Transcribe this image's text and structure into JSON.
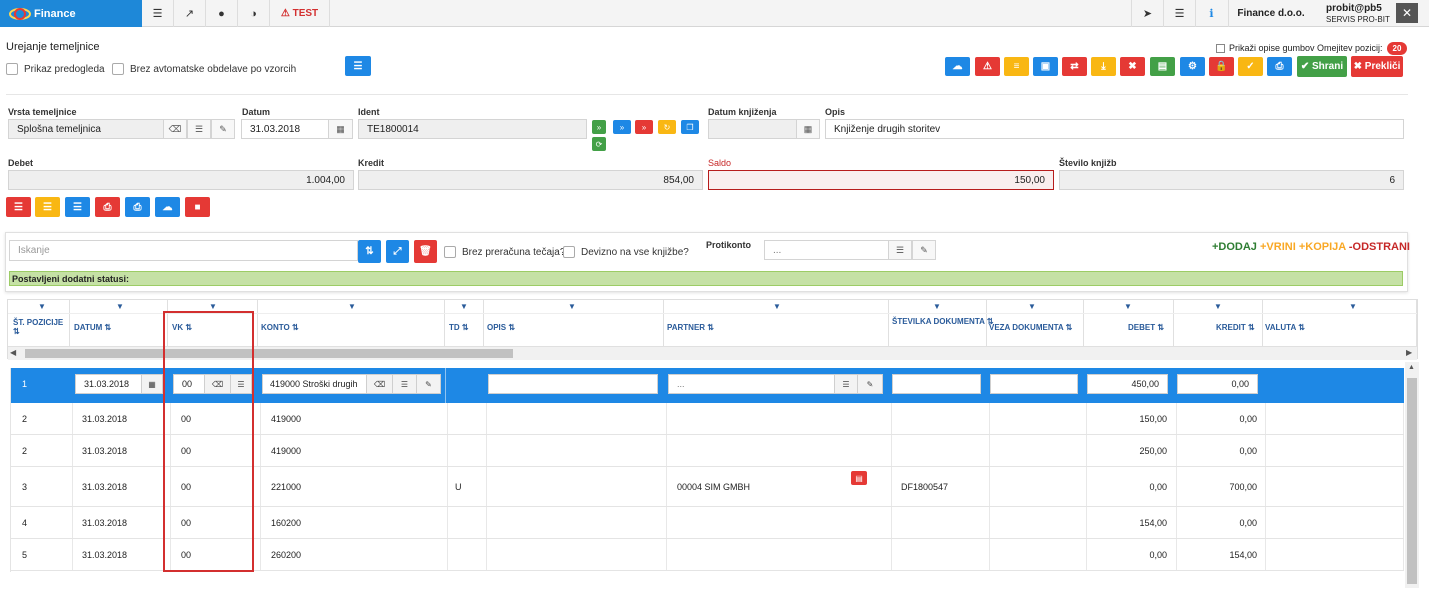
{
  "topbar": {
    "app_name": "Finance",
    "test_label": "TEST",
    "test_icon": "⚠",
    "company": "Finance d.o.o.",
    "user_name": "probit@pb5",
    "user_org": "SERVIS PRO-BIT"
  },
  "header": {
    "title": "Urejanje temeljnice",
    "preview_label": "Prikaz predogleda",
    "no_auto_label": "Brez avtomatske obdelave po vzorcih",
    "show_desc_label": "Prikaži opise gumbov Omejitev pozicij:",
    "limit_badge": "20",
    "save_label": "✔ Shrani",
    "cancel_label": "✖ Prekliči"
  },
  "form": {
    "vrsta_label": "Vrsta temeljnice",
    "vrsta_value": "Splošna temeljnica",
    "datum_label": "Datum",
    "datum_value": "31.03.2018",
    "ident_label": "Ident",
    "ident_value": "TE1800014",
    "datum_knj_label": "Datum knjiženja",
    "datum_knj_value": "",
    "opis_label": "Opis",
    "opis_value": "Knjiženje drugih storitev",
    "debet_label": "Debet",
    "debet_value": "1.004,00",
    "kredit_label": "Kredit",
    "kredit_value": "854,00",
    "saldo_label": "Saldo",
    "saldo_value": "150,00",
    "stevilo_label": "Število knjižb",
    "stevilo_value": "6"
  },
  "toolbar": {
    "search_placeholder": "Iskanje",
    "brez_tecaja_label": "Brez preračuna tečaja?",
    "devizno_label": "Devizno na vse knjižbe?",
    "protikonto_label": "Protikonto",
    "protikonto_value": "...",
    "dodaj": "+DODAJ",
    "vrini": "+VRINI",
    "kopija": "+KOPIJA",
    "odstrani": "-ODSTRANI",
    "status_text": "Postavljeni dodatni statusi:"
  },
  "grid": {
    "columns": [
      "ŠT. POZICIJE",
      "DATUM",
      "VK",
      "KONTO",
      "TD",
      "OPIS",
      "PARTNER",
      "ŠTEVILKA DOKUMENTA",
      "VEZA DOKUMENTA",
      "DEBET",
      "KREDIT",
      "VALUTA"
    ],
    "edit_row": {
      "pos": "1",
      "datum": "31.03.2018",
      "vk": "00",
      "konto": "419000 Stroški drugih",
      "partner": "...",
      "debet": "450,00",
      "kredit": "0,00"
    },
    "rows": [
      {
        "pos": "2",
        "datum": "31.03.2018",
        "vk": "00",
        "konto": "419000",
        "td": "",
        "partner": "",
        "dok": "",
        "debet": "150,00",
        "kredit": "0,00"
      },
      {
        "pos": "2",
        "datum": "31.03.2018",
        "vk": "00",
        "konto": "419000",
        "td": "",
        "partner": "",
        "dok": "",
        "debet": "250,00",
        "kredit": "0,00"
      },
      {
        "pos": "3",
        "datum": "31.03.2018",
        "vk": "00",
        "konto": "221000",
        "td": "U",
        "partner": "00004 SIM GMBH",
        "dok": "DF1800547",
        "debet": "0,00",
        "kredit": "700,00"
      },
      {
        "pos": "4",
        "datum": "31.03.2018",
        "vk": "00",
        "konto": "160200",
        "td": "",
        "partner": "",
        "dok": "",
        "debet": "154,00",
        "kredit": "0,00"
      },
      {
        "pos": "5",
        "datum": "31.03.2018",
        "vk": "00",
        "konto": "260200",
        "td": "",
        "partner": "",
        "dok": "",
        "debet": "0,00",
        "kredit": "154,00"
      }
    ]
  },
  "colors": {
    "primary": "#1e88e5",
    "danger": "#e53935",
    "warning": "#f9b713",
    "success": "#43a047",
    "selected_row": "#1e88e5",
    "highlight_box": "#d32f2f"
  }
}
